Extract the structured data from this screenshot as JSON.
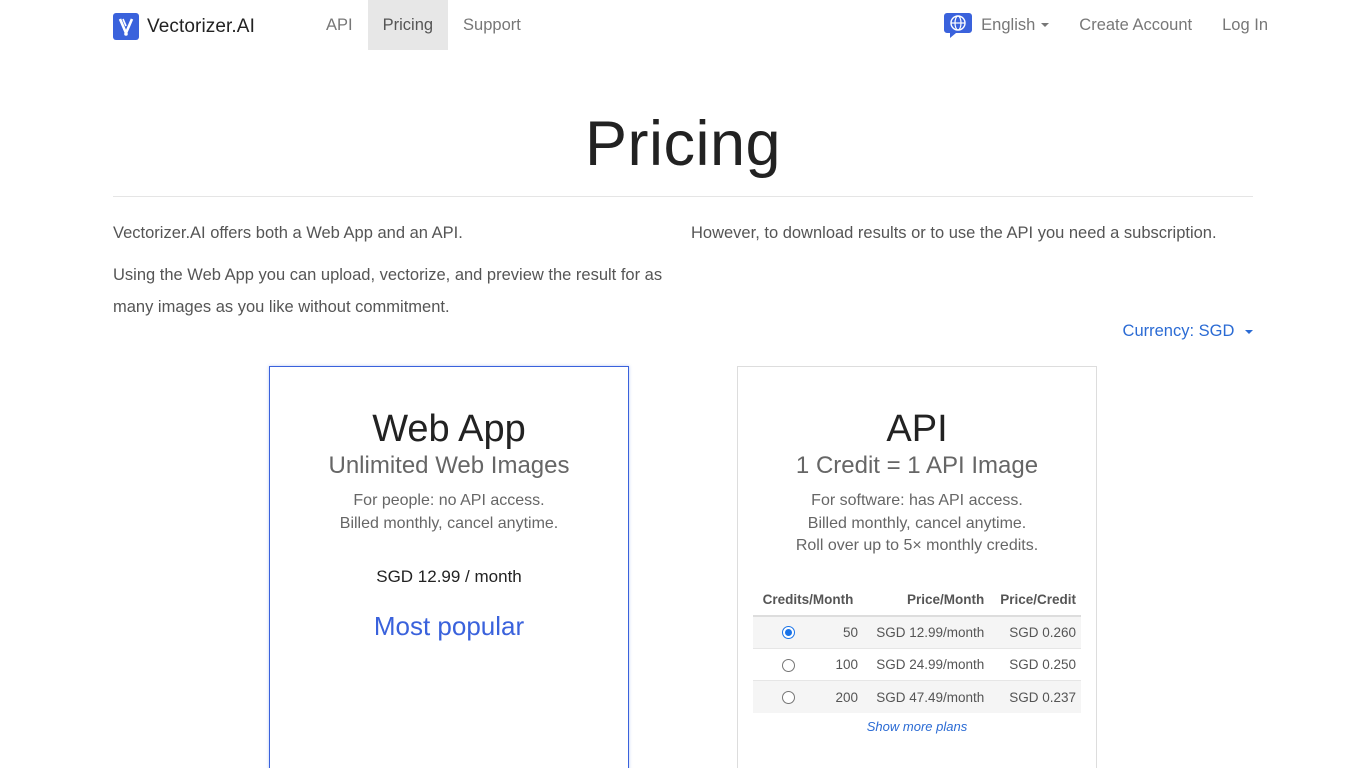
{
  "brand": {
    "name": "Vectorizer.AI",
    "logo_icon": "vectorizer-logo-icon",
    "accent": "#3a62dc"
  },
  "nav": {
    "left": [
      {
        "label": "API",
        "active": false
      },
      {
        "label": "Pricing",
        "active": true
      },
      {
        "label": "Support",
        "active": false
      }
    ],
    "language": {
      "icon": "globe-chat-icon",
      "label": "English"
    },
    "create_account": "Create Account",
    "log_in": "Log In"
  },
  "page": {
    "title": "Pricing",
    "intro": {
      "p1": "Vectorizer.AI offers both a Web App and an API.",
      "p2": "Using the Web App you can upload, vectorize, and preview the result for as many images as you like without commitment.",
      "p3": "However, to download results or to use the API you need a subscription."
    },
    "currency_selector": "Currency: SGD"
  },
  "plans": {
    "web_app": {
      "title": "Web App",
      "subtitle": "Unlimited Web Images",
      "note1": "For people: no API access.",
      "note2": "Billed monthly, cancel anytime.",
      "price": "SGD 12.99 / month",
      "badge": "Most popular"
    },
    "api": {
      "title": "API",
      "subtitle": "1 Credit = 1 API Image",
      "note1": "For software: has API access.",
      "note2": "Billed monthly, cancel anytime.",
      "note3": "Roll over up to 5× monthly credits.",
      "table": {
        "headers": [
          "Credits/Month",
          "Price/Month",
          "Price/Credit"
        ],
        "rows": [
          {
            "selected": true,
            "credits": "50",
            "price_month": "SGD 12.99/month",
            "price_credit": "SGD 0.260"
          },
          {
            "selected": false,
            "credits": "100",
            "price_month": "SGD 24.99/month",
            "price_credit": "SGD 0.250"
          },
          {
            "selected": false,
            "credits": "200",
            "price_month": "SGD 47.49/month",
            "price_credit": "SGD 0.237"
          }
        ]
      },
      "show_more": "Show more plans"
    }
  }
}
